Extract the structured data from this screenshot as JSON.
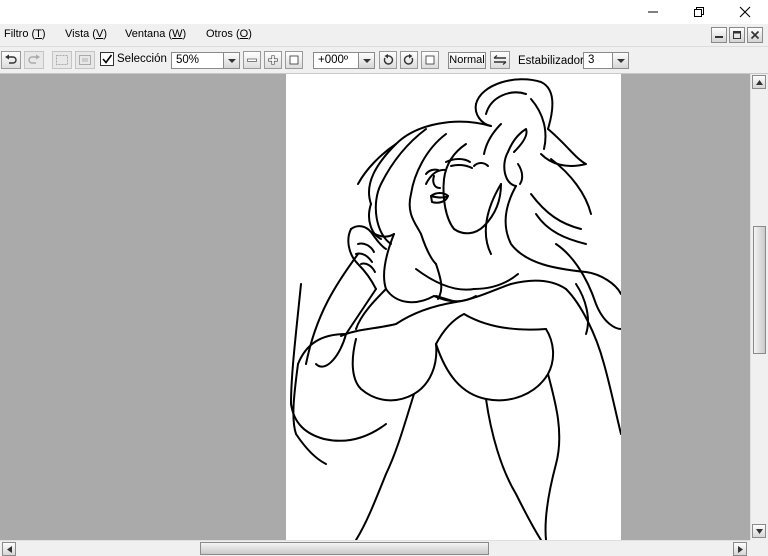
{
  "window": {
    "icons": {
      "minimize": "minimize-icon",
      "restore": "restore-icon",
      "close": "close-icon"
    }
  },
  "menu": {
    "items": [
      {
        "label": "Filtro (T)",
        "underline": "T"
      },
      {
        "label": "Vista (V)",
        "underline": "V"
      },
      {
        "label": "Ventana (W)",
        "underline": "W"
      },
      {
        "label": "Otros (O)",
        "underline": "O"
      }
    ],
    "mdi_icons": [
      "mdi-minimize-icon",
      "mdi-restore-icon",
      "mdi-close-icon"
    ]
  },
  "toolbar": {
    "undo_icon": "undo-icon",
    "redo_icon": "redo-icon",
    "selection_checked": true,
    "selection_label": "Selección",
    "zoom_value": "50%",
    "zoom_buttons": [
      "zoom-out-icon",
      "zoom-in-icon",
      "zoom-reset-icon"
    ],
    "rotation_value": "+000º",
    "rotate_buttons": [
      "rotate-ccw-icon",
      "rotate-cw-icon",
      "rotate-reset-icon"
    ],
    "blend_mode": "Normal",
    "flip_icon": "flip-horizontal-icon",
    "stabilizer_label": "Estabilizador",
    "stabilizer_value": "3"
  },
  "canvas": {
    "background_color": "#aaaaaa",
    "paper_color": "#ffffff",
    "content": "line-art-drawing"
  },
  "scroll": {
    "vertical_position": 0.36,
    "horizontal_position": 0.36
  }
}
